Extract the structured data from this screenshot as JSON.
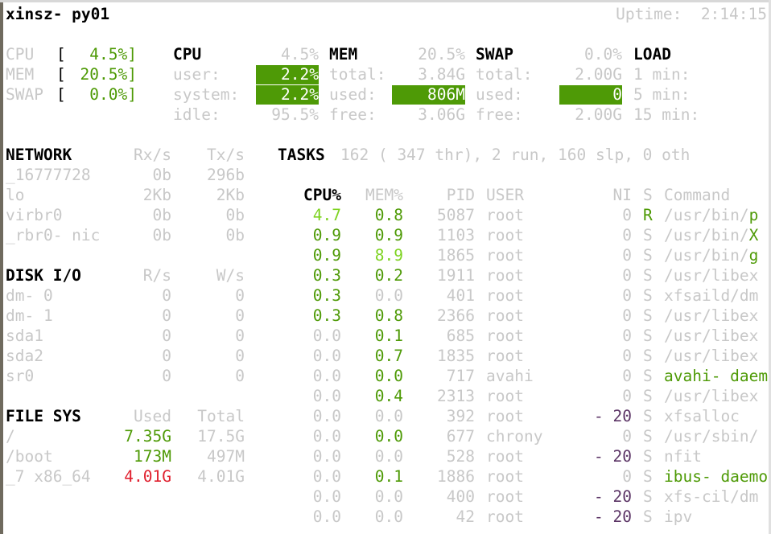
{
  "header": {
    "hostname": "xinsz- py01",
    "uptime": "Uptime:  2:14:15"
  },
  "quicklook": [
    {
      "label": "CPU",
      "value": "4.5%]"
    },
    {
      "label": "MEM",
      "value": "20.5%]"
    },
    {
      "label": "SWAP",
      "value": "0.0%]"
    }
  ],
  "bracket": "[",
  "cpu": {
    "title": "CPU",
    "total": "4.5%",
    "rows": [
      {
        "label": "user:",
        "value": "2.2%",
        "bar": true
      },
      {
        "label": "system:",
        "value": "2.2%",
        "bar": true
      },
      {
        "label": "idle:",
        "value": "95.5%",
        "bar": false
      }
    ]
  },
  "mem": {
    "title": "MEM",
    "total": "20.5%",
    "rows": [
      {
        "label": "total:",
        "value": "3.84G",
        "bar": false
      },
      {
        "label": "used:",
        "value": "806M",
        "bar": true
      },
      {
        "label": "free:",
        "value": "3.06G",
        "bar": false
      }
    ]
  },
  "swap": {
    "title": "SWAP",
    "total": "0.0%",
    "rows": [
      {
        "label": "total:",
        "value": "2.00G",
        "bar": false
      },
      {
        "label": "used:",
        "value": "0",
        "bar": true
      },
      {
        "label": "free:",
        "value": "2.00G",
        "bar": false
      }
    ]
  },
  "load": {
    "title": "LOAD",
    "rows": [
      "1 min:",
      "5 min:",
      "15 min:"
    ]
  },
  "network": {
    "title": "NETWORK",
    "col1": "Rx/s",
    "col2": "Tx/s",
    "rows": [
      [
        "_16777728",
        "0b",
        "296b"
      ],
      [
        "lo",
        "2Kb",
        "2Kb"
      ],
      [
        "virbr0",
        "0b",
        "0b"
      ],
      [
        "_rbr0- nic",
        "0b",
        "0b"
      ]
    ]
  },
  "disk": {
    "title": "DISK I/O",
    "col1": "R/s",
    "col2": "W/s",
    "rows": [
      [
        "dm- 0",
        "0",
        "0"
      ],
      [
        "dm- 1",
        "0",
        "0"
      ],
      [
        "sda1",
        "0",
        "0"
      ],
      [
        "sda2",
        "0",
        "0"
      ],
      [
        "sr0",
        "0",
        "0"
      ]
    ]
  },
  "fs": {
    "title": "FILE SYS",
    "col1": "Used",
    "col2": "Total",
    "rows": [
      [
        "/",
        "7.35G",
        "17.5G",
        "g"
      ],
      [
        "/boot",
        "173M",
        "497M",
        "g"
      ],
      [
        "_7 x86_64",
        "4.01G",
        "4.01G",
        "red"
      ]
    ]
  },
  "tasks": {
    "title": "TASKS",
    "summary": "162 ( 347 thr), 2 run, 160 slp, 0 oth"
  },
  "process_headers": {
    "cpu": "CPU%",
    "mem": "MEM%",
    "pid": "PID",
    "user": "USER",
    "ni": "NI",
    "s": "S",
    "cmd": "Command"
  },
  "processes": [
    {
      "cpu": "4.7",
      "cc": "b",
      "mem": "0.8",
      "mc": "g",
      "pid": "5087",
      "user": "root",
      "ni": "0",
      "nc": "d",
      "s": "R",
      "sc": "g",
      "cmd": [
        [
          "/usr/bin/",
          "d"
        ],
        [
          "p",
          "g"
        ]
      ]
    },
    {
      "cpu": "0.9",
      "cc": "g",
      "mem": "0.9",
      "mc": "g",
      "pid": "1103",
      "user": "root",
      "ni": "0",
      "nc": "d",
      "s": "S",
      "sc": "d",
      "cmd": [
        [
          "/usr/bin/",
          "d"
        ],
        [
          "X",
          "g"
        ]
      ]
    },
    {
      "cpu": "0.9",
      "cc": "g",
      "mem": "8.9",
      "mc": "b",
      "pid": "1865",
      "user": "root",
      "ni": "0",
      "nc": "d",
      "s": "S",
      "sc": "d",
      "cmd": [
        [
          "/usr/bin/",
          "d"
        ],
        [
          "g",
          "g"
        ]
      ]
    },
    {
      "cpu": "0.3",
      "cc": "g",
      "mem": "0.2",
      "mc": "g",
      "pid": "1911",
      "user": "root",
      "ni": "0",
      "nc": "d",
      "s": "S",
      "sc": "d",
      "cmd": [
        [
          "/usr/libex",
          "d"
        ]
      ]
    },
    {
      "cpu": "0.3",
      "cc": "g",
      "mem": "0.0",
      "mc": "d",
      "pid": "401",
      "user": "root",
      "ni": "0",
      "nc": "d",
      "s": "S",
      "sc": "d",
      "cmd": [
        [
          "xfsaild/dm",
          "d"
        ]
      ]
    },
    {
      "cpu": "0.3",
      "cc": "g",
      "mem": "0.8",
      "mc": "g",
      "pid": "2366",
      "user": "root",
      "ni": "0",
      "nc": "d",
      "s": "S",
      "sc": "d",
      "cmd": [
        [
          "/usr/libex",
          "d"
        ]
      ]
    },
    {
      "cpu": "0.0",
      "cc": "d",
      "mem": "0.1",
      "mc": "g",
      "pid": "685",
      "user": "root",
      "ni": "0",
      "nc": "d",
      "s": "S",
      "sc": "d",
      "cmd": [
        [
          "/usr/libex",
          "d"
        ]
      ]
    },
    {
      "cpu": "0.0",
      "cc": "d",
      "mem": "0.7",
      "mc": "g",
      "pid": "1835",
      "user": "root",
      "ni": "0",
      "nc": "d",
      "s": "S",
      "sc": "d",
      "cmd": [
        [
          "/usr/libex",
          "d"
        ]
      ]
    },
    {
      "cpu": "0.0",
      "cc": "d",
      "mem": "0.0",
      "mc": "g",
      "pid": "717",
      "user": "avahi",
      "ni": "0",
      "nc": "d",
      "s": "S",
      "sc": "d",
      "cmd": [
        [
          "avahi- daem",
          "g"
        ]
      ]
    },
    {
      "cpu": "0.0",
      "cc": "d",
      "mem": "0.4",
      "mc": "g",
      "pid": "2313",
      "user": "root",
      "ni": "0",
      "nc": "d",
      "s": "S",
      "sc": "d",
      "cmd": [
        [
          "/usr/libex",
          "d"
        ]
      ]
    },
    {
      "cpu": "0.0",
      "cc": "d",
      "mem": "0.0",
      "mc": "d",
      "pid": "392",
      "user": "root",
      "ni": "- 20",
      "nc": "p",
      "s": "S",
      "sc": "d",
      "cmd": [
        [
          "xfsalloc",
          "d"
        ]
      ]
    },
    {
      "cpu": "0.0",
      "cc": "d",
      "mem": "0.0",
      "mc": "g",
      "pid": "677",
      "user": "chrony",
      "ni": "0",
      "nc": "d",
      "s": "S",
      "sc": "d",
      "cmd": [
        [
          "/usr/sbin/",
          "d"
        ]
      ]
    },
    {
      "cpu": "0.0",
      "cc": "d",
      "mem": "0.0",
      "mc": "d",
      "pid": "528",
      "user": "root",
      "ni": "- 20",
      "nc": "p",
      "s": "S",
      "sc": "d",
      "cmd": [
        [
          "nfit",
          "d"
        ]
      ]
    },
    {
      "cpu": "0.0",
      "cc": "d",
      "mem": "0.1",
      "mc": "g",
      "pid": "1886",
      "user": "root",
      "ni": "0",
      "nc": "d",
      "s": "S",
      "sc": "d",
      "cmd": [
        [
          "ibus- daemo",
          "g"
        ]
      ]
    },
    {
      "cpu": "0.0",
      "cc": "d",
      "mem": "0.0",
      "mc": "d",
      "pid": "400",
      "user": "root",
      "ni": "- 20",
      "nc": "p",
      "s": "S",
      "sc": "d",
      "cmd": [
        [
          "xfs-cil/dm",
          "d"
        ]
      ]
    },
    {
      "cpu": "0.0",
      "cc": "d",
      "mem": "0.0",
      "mc": "d",
      "pid": "42",
      "user": "root",
      "ni": "- 20",
      "nc": "p",
      "s": "S",
      "sc": "d",
      "cmd": [
        [
          "ipv",
          "d"
        ]
      ]
    }
  ],
  "colors": {
    "green": "#4e9a06",
    "bright_green": "#7ed321",
    "red": "#e0202e",
    "purple": "#5c3566",
    "dim": "#c8c8c8",
    "bar": "#4e9a06"
  }
}
